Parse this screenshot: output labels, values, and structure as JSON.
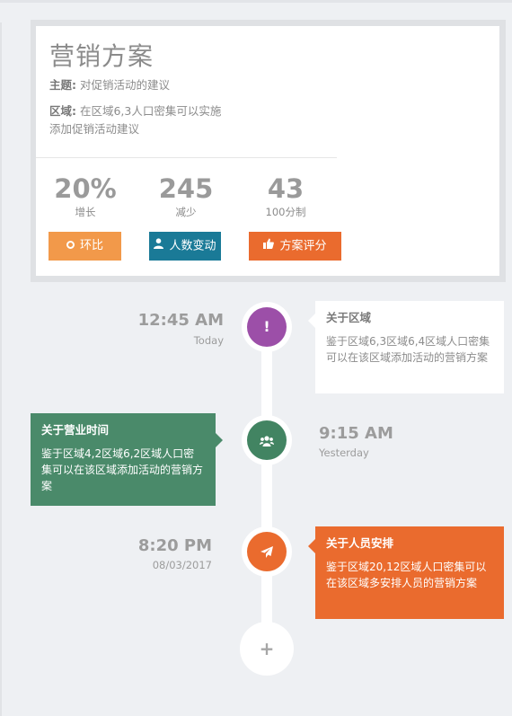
{
  "card": {
    "title": "营销方案",
    "topic_label": "主题:",
    "topic_text": " 对促销活动的建议",
    "region_label": "区域:",
    "region_text": " 在区域6,3人口密集可以实施添加促销活动建议",
    "stats": [
      {
        "value": "20%",
        "label": "增长"
      },
      {
        "value": "245",
        "label": "减少"
      },
      {
        "value": "43",
        "label": "100分制"
      }
    ],
    "buttons": [
      {
        "label": "环比",
        "icon": "ring-icon",
        "color": "#f2994a"
      },
      {
        "label": "人数变动",
        "icon": "user-icon",
        "color": "#1a7a97"
      },
      {
        "label": "方案评分",
        "icon": "thumbs-up-icon",
        "color": "#ea6b2e"
      }
    ]
  },
  "timeline": {
    "items": [
      {
        "time": "12:45 AM",
        "sub": "Today",
        "icon": "exclamation-icon",
        "color": "#9c4fa8",
        "title": "关于区域",
        "text": "鉴于区域6,3区域6,4区域人口密集可以在该区域添加活动的营销方案"
      },
      {
        "time": "9:15 AM",
        "sub": "Yesterday",
        "icon": "users-icon",
        "color": "#428462",
        "title": "关于营业时间",
        "text": "鉴于区域4,2区域6,2区域人口密集可以在该区域添加活动的营销方案"
      },
      {
        "time": "8:20 PM",
        "sub": "08/03/2017",
        "icon": "paper-plane-icon",
        "color": "#ea6b2e",
        "title": "关于人员安排",
        "text": "鉴于区域20,12区域人口密集可以在该区域多安排人员的营销方案"
      }
    ],
    "add_icon": "+"
  }
}
